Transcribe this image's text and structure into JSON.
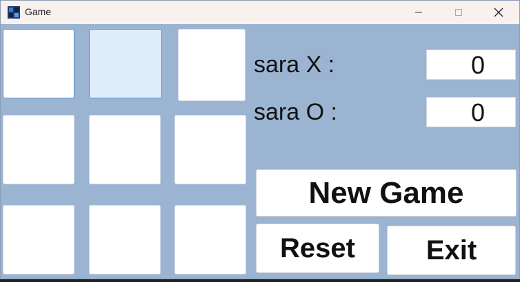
{
  "window": {
    "title": "Game"
  },
  "board": {
    "cells": [
      "",
      "",
      "",
      "",
      "",
      "",
      "",
      "",
      ""
    ]
  },
  "scores": [
    {
      "label": "sara X :",
      "value": "0"
    },
    {
      "label": "sara O :",
      "value": "0"
    }
  ],
  "buttons": {
    "new_game": "New Game",
    "reset": "Reset",
    "exit": "Exit"
  }
}
